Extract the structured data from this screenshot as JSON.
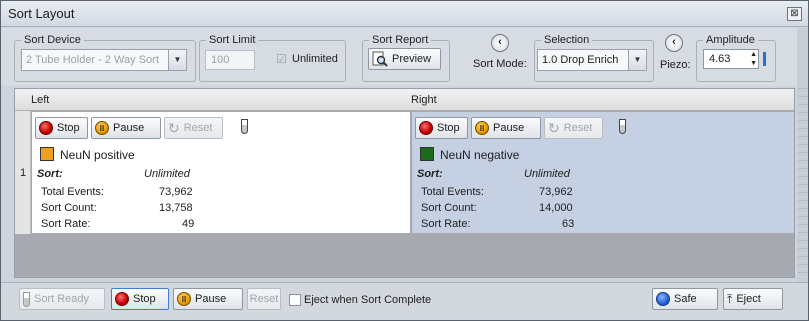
{
  "window": {
    "title": "Sort Layout",
    "close_glyph": "⊠"
  },
  "sort_device": {
    "legend": "Sort Device",
    "value": "2 Tube Holder - 2 Way Sort"
  },
  "sort_limit": {
    "legend": "Sort Limit",
    "placeholder": "100",
    "checkbox_label": "Unlimited"
  },
  "sort_report": {
    "legend": "Sort Report",
    "preview_label": "Preview"
  },
  "sort_mode": {
    "label": "Sort Mode:",
    "prev_glyph": "‹"
  },
  "selection": {
    "legend": "Selection",
    "value": "1.0 Drop Enrich"
  },
  "piezo": {
    "label": "Piezo:",
    "prev_glyph": "‹"
  },
  "amplitude": {
    "legend": "Amplitude",
    "value": "4.63"
  },
  "grid": {
    "headers": {
      "left": "Left",
      "right": "Right"
    },
    "row_number": "1",
    "left": {
      "stop_label": "Stop",
      "pause_label": "Pause",
      "reset_label": "Reset",
      "population": "NeuN positive",
      "population_color": "#f0a020",
      "sort_label": "Sort:",
      "sort_value": "Unlimited",
      "total_events_label": "Total Events:",
      "total_events": "73,962",
      "sort_count_label": "Sort Count:",
      "sort_count": "13,758",
      "sort_rate_label": "Sort Rate:",
      "sort_rate": "49"
    },
    "right": {
      "stop_label": "Stop",
      "pause_label": "Pause",
      "reset_label": "Reset",
      "population": "NeuN negative",
      "population_color": "#1a6a1a",
      "sort_label": "Sort:",
      "sort_value": "Unlimited",
      "total_events_label": "Total Events:",
      "total_events": "73,962",
      "sort_count_label": "Sort Count:",
      "sort_count": "14,000",
      "sort_rate_label": "Sort Rate:",
      "sort_rate": "63"
    }
  },
  "bottom": {
    "sort_ready_label": "Sort Ready",
    "stop_label": "Stop",
    "pause_label": "Pause",
    "reset_label": "Reset",
    "eject_when_complete_label": "Eject when Sort Complete",
    "safe_label": "Safe",
    "eject_label": "Eject"
  }
}
